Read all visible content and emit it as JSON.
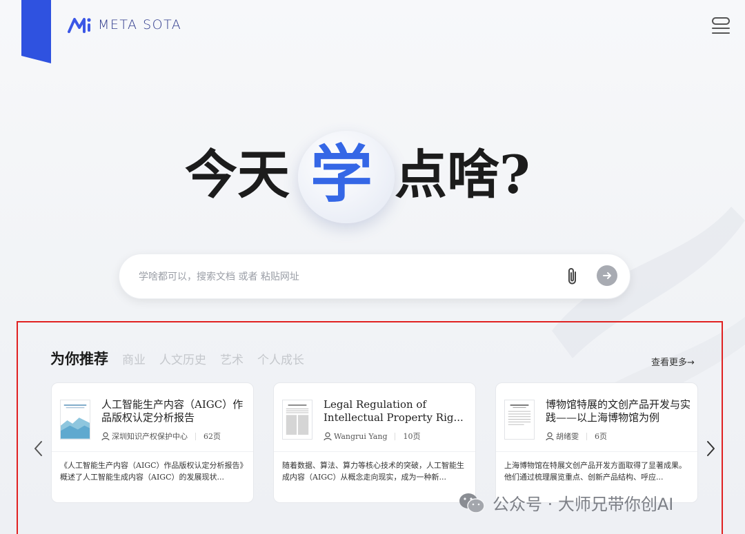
{
  "brand": {
    "name": "META SOTA"
  },
  "hero": {
    "left": "今天",
    "highlight": "学",
    "right": "点啥?"
  },
  "search": {
    "placeholder": "学啥都可以，搜索文档 或者 粘贴网址"
  },
  "recommend": {
    "tabs": [
      {
        "label": "为你推荐",
        "active": true
      },
      {
        "label": "商业",
        "active": false
      },
      {
        "label": "人文历史",
        "active": false
      },
      {
        "label": "艺术",
        "active": false
      },
      {
        "label": "个人成长",
        "active": false
      }
    ],
    "see_more": "查看更多→",
    "cards": [
      {
        "title": "人工智能生产内容（AIGC）作品版权认定分析报告",
        "author": "深圳知识产权保护中心",
        "pages": "62页",
        "summary": "《人工智能生产内容（AIGC）作品版权认定分析报告》概述了人工智能生成内容（AIGC）的发展现状..."
      },
      {
        "title": "Legal Regulation of Intellectual Property Rig...",
        "author": "Wangrui Yang",
        "pages": "10页",
        "summary": "随着数据、算法、算力等核心技术的突破，人工智能生成内容（AIGC）从概念走向现实，成为一种新..."
      },
      {
        "title": "博物馆特展的文创产品开发与实践——以上海博物馆为例",
        "author": "胡绪雯",
        "pages": "6页",
        "summary": "上海博物馆在特展文创产品开发方面取得了显著成果。他们通过梳理展览重点、创新产品结构、呼应..."
      }
    ]
  },
  "watermark": {
    "text": "公众号 · 大师兄带你创AI"
  },
  "colors": {
    "accent": "#3567e6",
    "ribbon": "#2f52e0",
    "frame": "#e02020"
  },
  "icons": [
    "logo-icon",
    "menu-icon",
    "paperclip-icon",
    "arrow-right-icon",
    "chevron-left-icon",
    "chevron-right-icon",
    "user-icon",
    "wechat-icon"
  ]
}
